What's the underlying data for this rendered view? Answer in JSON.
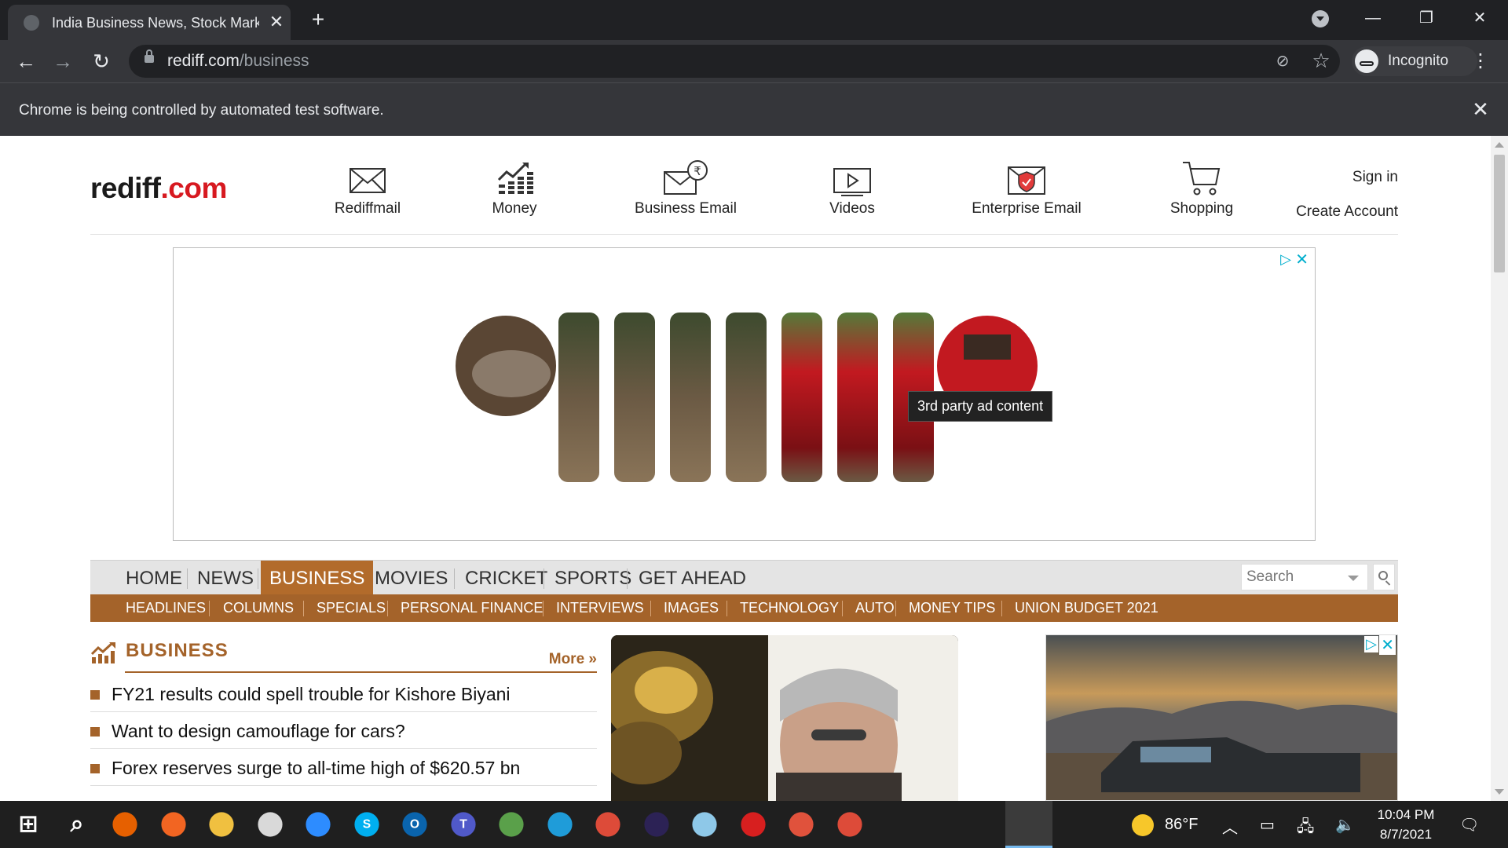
{
  "browser": {
    "tab_title": "India Business News, Stock Mark",
    "tab_close": "✕",
    "new_tab": "+",
    "url_host": "rediff.com",
    "url_path": "/business",
    "profile_label": "Incognito",
    "infobar_text": "Chrome is being controlled by automated test software.",
    "minimize": "—",
    "restore": "❐",
    "close": "✕"
  },
  "header": {
    "logo_main": "rediff",
    "logo_suffix": ".com",
    "items": [
      {
        "label": "Rediffmail",
        "icon": "mail-icon"
      },
      {
        "label": "Money",
        "icon": "money-chart-icon"
      },
      {
        "label": "Business Email",
        "icon": "business-email-icon"
      },
      {
        "label": "Videos",
        "icon": "video-icon"
      },
      {
        "label": "Enterprise Email",
        "icon": "enterprise-email-icon"
      },
      {
        "label": "Shopping",
        "icon": "cart-icon"
      }
    ],
    "sign_in": "Sign in",
    "create_account": "Create Account"
  },
  "top_ad": {
    "choices": "▷",
    "close": "✕",
    "tooltip": "3rd party ad content"
  },
  "main_nav": {
    "items": [
      "HOME",
      "NEWS",
      "BUSINESS",
      "MOVIES",
      "CRICKET",
      "SPORTS",
      "GET AHEAD"
    ],
    "active": "BUSINESS",
    "search_placeholder": "Search"
  },
  "sub_nav": {
    "items": [
      "HEADLINES",
      "COLUMNS",
      "SPECIALS",
      "PERSONAL FINANCE",
      "INTERVIEWS",
      "IMAGES",
      "TECHNOLOGY",
      "AUTO",
      "MONEY TIPS",
      "UNION BUDGET 2021"
    ]
  },
  "business": {
    "title": "BUSINESS",
    "more": "More »",
    "stories": [
      "FY21 results could spell trouble for Kishore Biyani",
      "Want to design camouflage for cars?",
      "Forex reserves surge to all-time high of $620.57 bn"
    ]
  },
  "right_ad": {
    "choices": "▷",
    "close": "✕"
  },
  "taskbar": {
    "apps": [
      {
        "name": "start-icon",
        "glyph": "⊞",
        "color": "#1f1f1f"
      },
      {
        "name": "search-icon",
        "glyph": "⌕",
        "color": "#1f1f1f"
      },
      {
        "name": "firefox-icon",
        "glyph": "",
        "color": "#e66000"
      },
      {
        "name": "pen-app-icon",
        "glyph": "",
        "color": "#f26522"
      },
      {
        "name": "file-explorer-icon",
        "glyph": "",
        "color": "#f0c040"
      },
      {
        "name": "paint-icon",
        "glyph": "",
        "color": "#d9d9d9"
      },
      {
        "name": "zoom-icon",
        "glyph": "",
        "color": "#2d8cff"
      },
      {
        "name": "skype-icon",
        "glyph": "S",
        "color": "#00aff0"
      },
      {
        "name": "outlook-icon",
        "glyph": "O",
        "color": "#0a64ad"
      },
      {
        "name": "teams-icon",
        "glyph": "T",
        "color": "#5059c9"
      },
      {
        "name": "spreadsheet-icon",
        "glyph": "",
        "color": "#5aa04a"
      },
      {
        "name": "edge-icon",
        "glyph": "",
        "color": "#1f9cd9"
      },
      {
        "name": "chrome-icon",
        "glyph": "",
        "color": "#dd4b39"
      },
      {
        "name": "eclipse-icon",
        "glyph": "",
        "color": "#2c2255"
      },
      {
        "name": "notes-icon",
        "glyph": "",
        "color": "#8ec8e8"
      },
      {
        "name": "acrobat-icon",
        "glyph": "",
        "color": "#d71f1f"
      },
      {
        "name": "package-icon",
        "glyph": "",
        "color": "#e0523c"
      },
      {
        "name": "chrome-active-icon",
        "glyph": "",
        "color": "#dd4b39"
      }
    ],
    "temperature": "86°F",
    "time": "10:04 PM",
    "date": "8/7/2021"
  }
}
